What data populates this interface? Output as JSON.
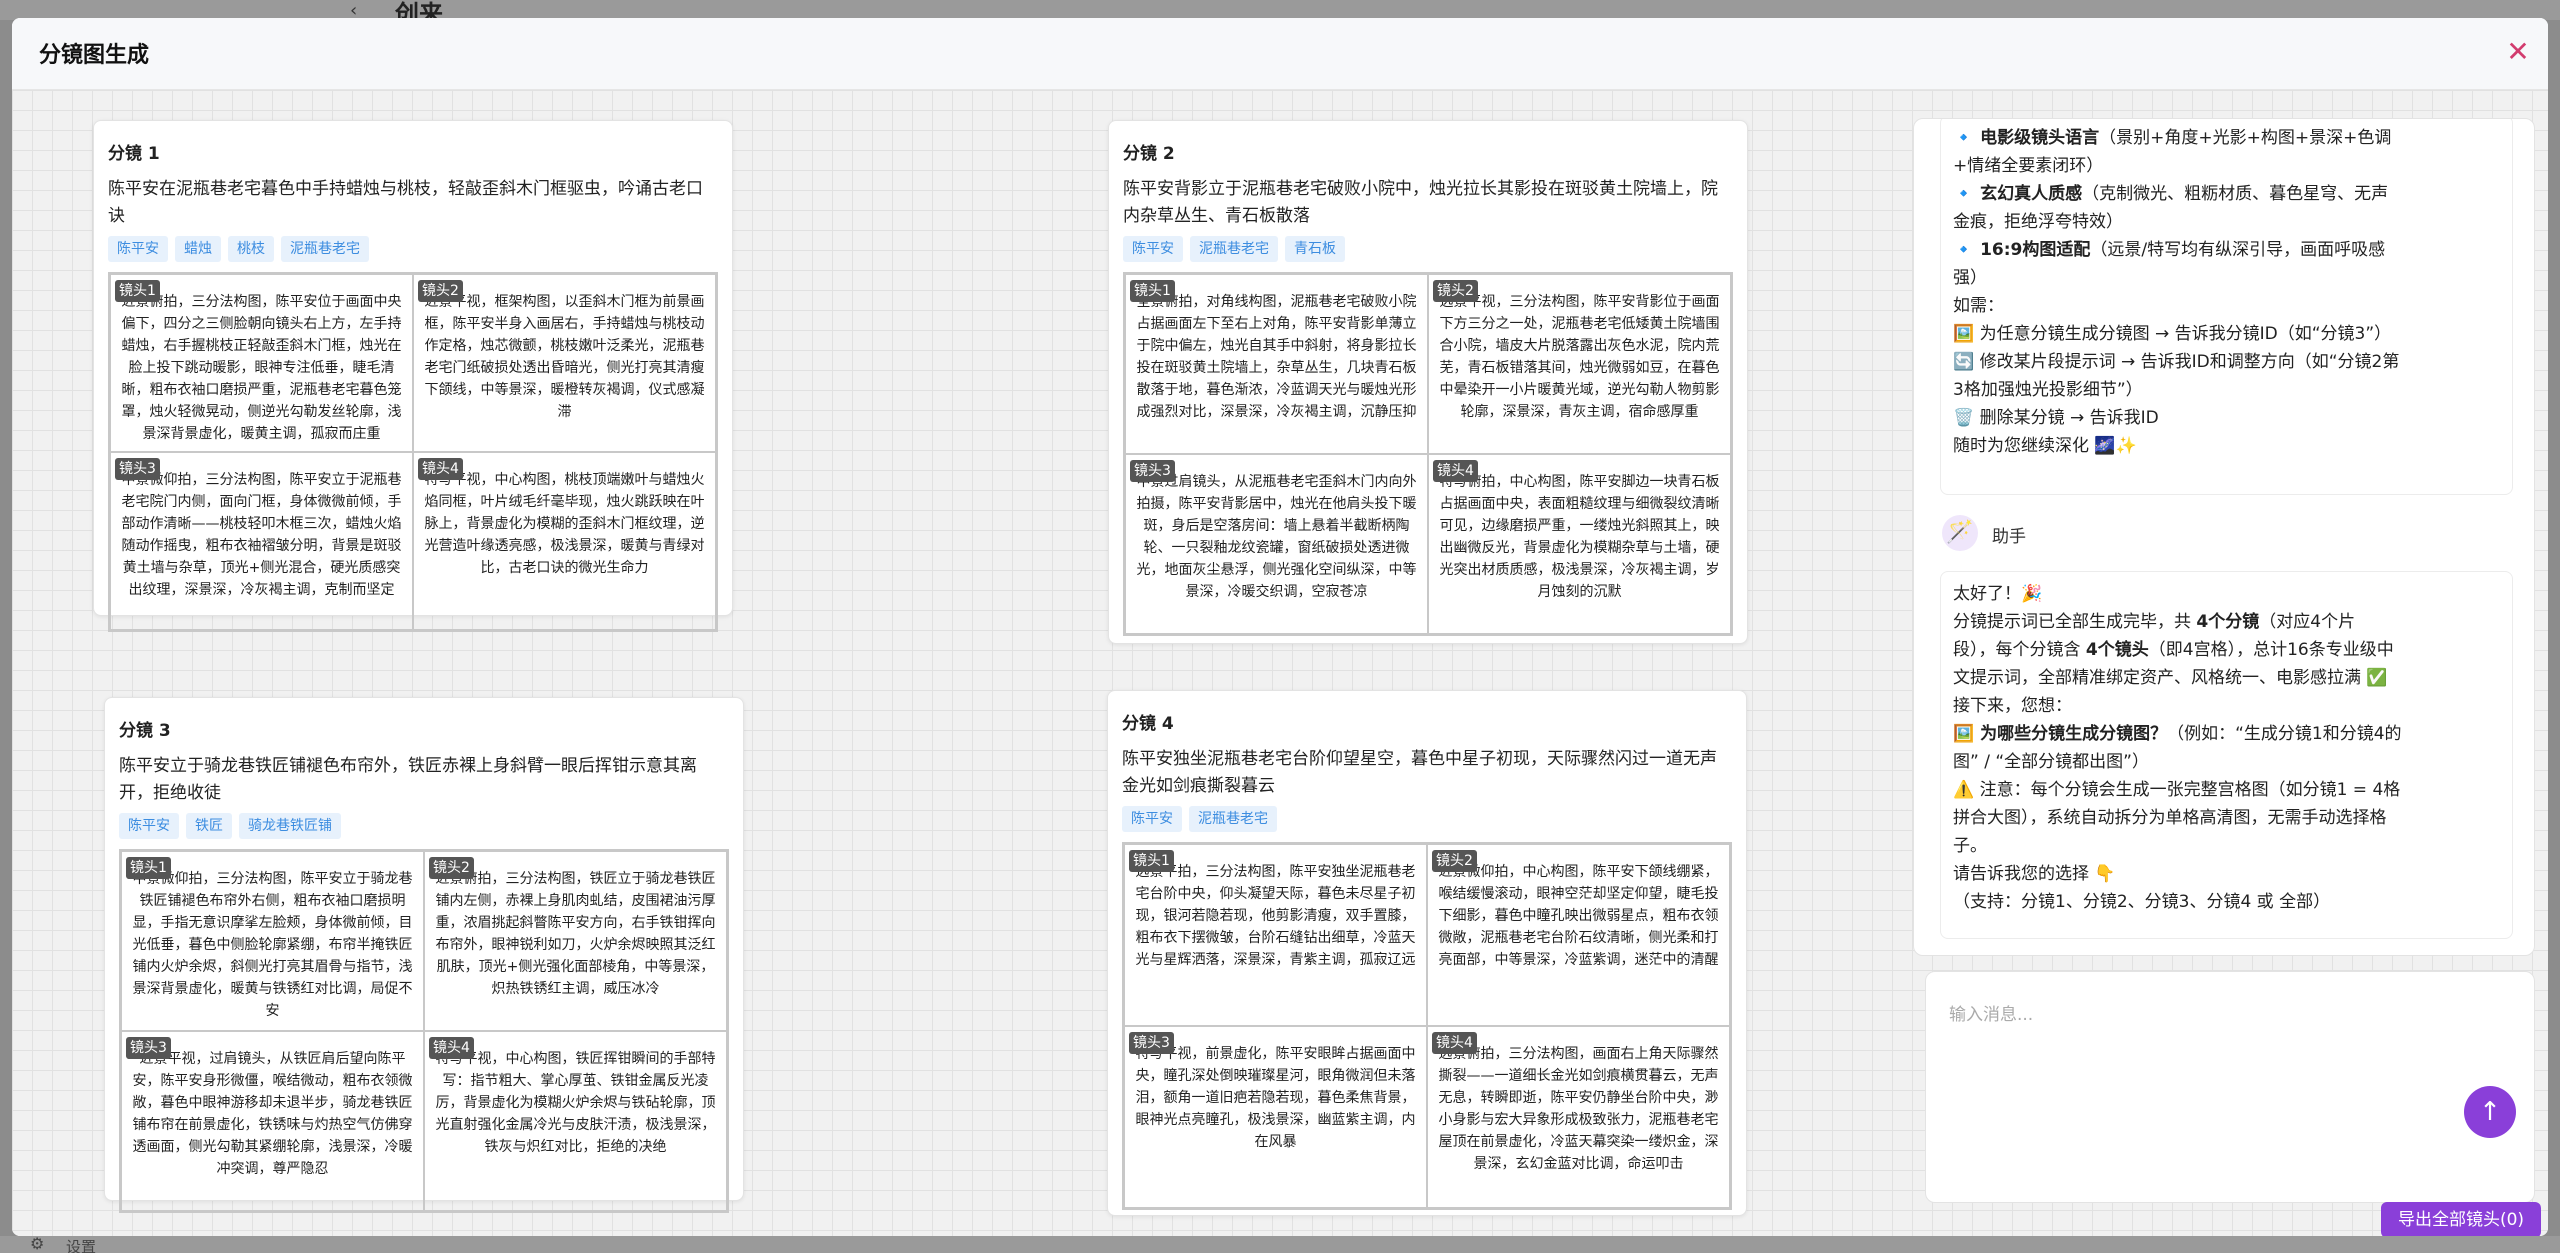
{
  "background": {
    "page_title": "创来",
    "back_icon": "‹",
    "footer_label": "设置"
  },
  "modal": {
    "title": "分镜图生成",
    "close_icon": "✕",
    "export_button": "导出全部镜头(0)"
  },
  "storyboards": [
    {
      "name": "分镜 1",
      "description": "陈平安在泥瓶巷老宅暮色中手持蜡烛与桃枝，轻敲歪斜木门框驱虫，吟诵古老口诀",
      "tags": [
        "陈平安",
        "蜡烛",
        "桃枝",
        "泥瓶巷老宅"
      ],
      "shots": [
        {
          "label": "镜头1",
          "text": "近景俯拍，三分法构图，陈平安位于画面中央偏下，四分之三侧脸朝向镜头右上方，左手持蜡烛，右手握桃枝正轻敲歪斜木门框，烛光在脸上投下跳动暖影，眼神专注低垂，睫毛清晰，粗布衣袖口磨损严重，泥瓶巷老宅暮色笼罩，烛火轻微晃动，侧逆光勾勒发丝轮廓，浅景深背景虚化，暖黄主调，孤寂而庄重"
        },
        {
          "label": "镜头2",
          "text": "近景平视，框架构图，以歪斜木门框为前景画框，陈平安半身入画居右，手持蜡烛与桃枝动作定格，烛芯微颤，桃枝嫩叶泛柔光，泥瓶巷老宅门纸破损处透出昏暗光，侧光打亮其清瘦下颌线，中等景深，暖橙转灰褐调，仪式感凝滞"
        },
        {
          "label": "镜头3",
          "text": "中景微仰拍，三分法构图，陈平安立于泥瓶巷老宅院门内侧，面向门框，身体微微前倾，手部动作清晰——桃枝轻叩木框三次，蜡烛火焰随动作摇曳，粗布衣袖褶皱分明，背景是斑驳黄土墙与杂草，顶光+侧光混合，硬光质感突出纹理，深景深，冷灰褐主调，克制而坚定"
        },
        {
          "label": "镜头4",
          "text": "特写平视，中心构图，桃枝顶端嫩叶与蜡烛火焰同框，叶片绒毛纤毫毕现，烛火跳跃映在叶脉上，背景虚化为模糊的歪斜木门框纹理，逆光营造叶缘透亮感，极浅景深，暖黄与青绿对比，古老口诀的微光生命力"
        }
      ]
    },
    {
      "name": "分镜 2",
      "description": "陈平安背影立于泥瓶巷老宅破败小院中，烛光拉长其影投在斑驳黄土院墙上，院内杂草丛生、青石板散落",
      "tags": [
        "陈平安",
        "泥瓶巷老宅",
        "青石板"
      ],
      "shots": [
        {
          "label": "镜头1",
          "text": "全景俯拍，对角线构图，泥瓶巷老宅破败小院占据画面左下至右上对角，陈平安背影单薄立于院中偏左，烛光自其手中斜射，将身影拉长投在斑驳黄土院墙上，杂草丛生，几块青石板散落于地，暮色渐浓，冷蓝调天光与暖烛光形成强烈对比，深景深，冷灰褐主调，沉静压抑"
        },
        {
          "label": "镜头2",
          "text": "远景平视，三分法构图，陈平安背影位于画面下方三分之一处，泥瓶巷老宅低矮黄土院墙围合小院，墙皮大片脱落露出灰色水泥，院内荒芜，青石板错落其间，烛光微弱如豆，在暮色中晕染开一小片暖黄光域，逆光勾勒人物剪影轮廓，深景深，青灰主调，宿命感厚重"
        },
        {
          "label": "镜头3",
          "text": "中景过肩镜头，从泥瓶巷老宅歪斜木门内向外拍摄，陈平安背影居中，烛光在他肩头投下暖斑，身后是空落房间：墙上悬着半截断柄陶轮、一只裂釉龙纹瓷罐，窗纸破损处透进微光，地面灰尘悬浮，侧光强化空间纵深，中等景深，冷暖交织调，空寂苍凉"
        },
        {
          "label": "镜头4",
          "text": "特写俯拍，中心构图，陈平安脚边一块青石板占据画面中央，表面粗糙纹理与细微裂纹清晰可见，边缘磨损严重，一缕烛光斜照其上，映出幽微反光，背景虚化为模糊杂草与土墙，硬光突出材质质感，极浅景深，冷灰褐主调，岁月蚀刻的沉默"
        }
      ]
    },
    {
      "name": "分镜 3",
      "description": "陈平安立于骑龙巷铁匠铺褪色布帘外，铁匠赤裸上身斜臂一眼后挥钳示意其离开，拒绝收徒",
      "tags": [
        "陈平安",
        "铁匠",
        "骑龙巷铁匠铺"
      ],
      "shots": [
        {
          "label": "镜头1",
          "text": "中景微仰拍，三分法构图，陈平安立于骑龙巷铁匠铺褪色布帘外右侧，粗布衣袖口磨损明显，手指无意识摩挲左脸颊，身体微前倾，目光低垂，暮色中侧脸轮廓紧绷，布帘半掩铁匠铺内火炉余烬，斜侧光打亮其眉骨与指节，浅景深背景虚化，暖黄与铁锈红对比调，局促不安"
        },
        {
          "label": "镜头2",
          "text": "近景俯拍，三分法构图，铁匠立于骑龙巷铁匠铺内左侧，赤裸上身肌肉虬结，皮围裙油污厚重，浓眉挑起斜瞥陈平安方向，右手铁钳挥向布帘外，眼神锐利如刀，火炉余烬映照其泛红肌肤，顶光+侧光强化面部棱角，中等景深，炽热铁锈红主调，威压冰冷"
        },
        {
          "label": "镜头3",
          "text": "近景平视，过肩镜头，从铁匠肩后望向陈平安，陈平安身形微僵，喉结微动，粗布衣领微敞，暮色中眼神游移却未退半步，骑龙巷铁匠铺布帘在前景虚化，铁锈味与灼热空气仿佛穿透画面，侧光勾勒其紧绷轮廓，浅景深，冷暖冲突调，尊严隐忍"
        },
        {
          "label": "镜头4",
          "text": "特写平视，中心构图，铁匠挥钳瞬间的手部特写：指节粗大、掌心厚茧、铁钳金属反光凌厉，背景虚化为模糊火炉余烬与铁砧轮廓，顶光直射强化金属冷光与皮肤汗渍，极浅景深，铁灰与炽红对比，拒绝的决绝"
        }
      ]
    },
    {
      "name": "分镜 4",
      "description": "陈平安独坐泥瓶巷老宅台阶仰望星空，暮色中星子初现，天际骤然闪过一道无声金光如剑痕撕裂暮云",
      "tags": [
        "陈平安",
        "泥瓶巷老宅"
      ],
      "shots": [
        {
          "label": "镜头1",
          "text": "远景平拍，三分法构图，陈平安独坐泥瓶巷老宅台阶中央，仰头凝望天际，暮色未尽星子初现，银河若隐若现，他剪影清瘦，双手置膝，粗布衣下摆微皱，台阶石缝钻出细草，冷蓝天光与星辉洒落，深景深，青紫主调，孤寂辽远"
        },
        {
          "label": "镜头2",
          "text": "近景微仰拍，中心构图，陈平安下颌线绷紧，喉结缓慢滚动，眼神空茫却坚定仰望，睫毛投下细影，暮色中瞳孔映出微弱星点，粗布衣领微敞，泥瓶巷老宅台阶石纹清晰，侧光柔和打亮面部，中等景深，冷蓝紫调，迷茫中的清醒"
        },
        {
          "label": "镜头3",
          "text": "特写平视，前景虚化，陈平安眼眸占据画面中央，瞳孔深处倒映璀璨星河，眼角微润但未落泪，额角一道旧疤若隐若现，暮色柔焦背景，眼神光点亮瞳孔，极浅景深，幽蓝紫主调，内在风暴"
        },
        {
          "label": "镜头4",
          "text": "远景俯拍，三分法构图，画面右上角天际骤然撕裂——一道细长金光如剑痕横贯暮云，无声无息，转瞬即逝，陈平安仍静坐台阶中央，渺小身影与宏大异象形成极致张力，泥瓶巷老宅屋顶在前景虚化，冷蓝天幕突染一缕炽金，深景深，玄幻金蓝对比调，命运叩击"
        }
      ]
    }
  ],
  "chat": {
    "message1_lines": [
      {
        "bold": "🔹 电影级镜头语言",
        "text": "（景别+角度+光影+构图+景深+色调"
      },
      {
        "bold": "",
        "text": "+情绪全要素闭环）"
      },
      {
        "bold": "🔹 玄幻真人质感",
        "text": "（克制微光、粗粝材质、暮色星穹、无声"
      },
      {
        "bold": "",
        "text": "金痕，拒绝浮夸特效）"
      },
      {
        "bold": "🔹 16:9构图适配",
        "text": "（远景/特写均有纵深引导，画面呼吸感"
      },
      {
        "bold": "",
        "text": "强）"
      },
      {
        "bold": "",
        "text": "如需："
      },
      {
        "bold": "",
        "text": "🖼️ 为任意分镜生成分镜图 → 告诉我分镜ID（如“分镜3”）"
      },
      {
        "bold": "",
        "text": "🔄 修改某片段提示词 → 告诉我ID和调整方向（如“分镜2第"
      },
      {
        "bold": "",
        "text": "3格加强烛光投影细节”）"
      },
      {
        "bold": "",
        "text": "🗑️ 删除某分镜 → 告诉我ID"
      },
      {
        "bold": "",
        "text": "随时为您继续深化 🌌✨"
      }
    ],
    "assistant_name": "助手",
    "assistant_avatar": "🪄",
    "message2_lines": [
      {
        "bold": "",
        "text": "太好了！🎉"
      },
      {
        "bold": "",
        "text": "分镜提示词已全部生成完毕，共 ",
        "bold2": "4个分镜",
        "text2": "（对应4个片"
      },
      {
        "bold": "",
        "text": "段），每个分镜含 ",
        "bold2": "4个镜头",
        "text2": "（即4宫格），总计16条专业级中"
      },
      {
        "bold": "",
        "text": "文提示词，全部精准绑定资产、风格统一、电影感拉满 ✅"
      },
      {
        "bold": "",
        "text": "接下来，您想："
      },
      {
        "bold": "🖼️ 为哪些分镜生成分镜图？",
        "text": "（例如：“生成分镜1和分镜4的"
      },
      {
        "bold": "",
        "text": "图” / “全部分镜都出图”）"
      },
      {
        "bold": "",
        "text": "⚠️ 注意：每个分镜会生成一张完整宫格图（如分镜1 = 4格"
      },
      {
        "bold": "",
        "text": "拼合大图），系统自动拆分为单格高清图，无需手动选择格"
      },
      {
        "bold": "",
        "text": "子。"
      },
      {
        "bold": "",
        "text": "请告诉我您的选择 👇"
      },
      {
        "bold": "",
        "text": "（支持：分镜1、分镜2、分镜3、分镜4 或 全部）"
      }
    ],
    "input_placeholder": "输入消息...",
    "send_icon": "↑"
  }
}
